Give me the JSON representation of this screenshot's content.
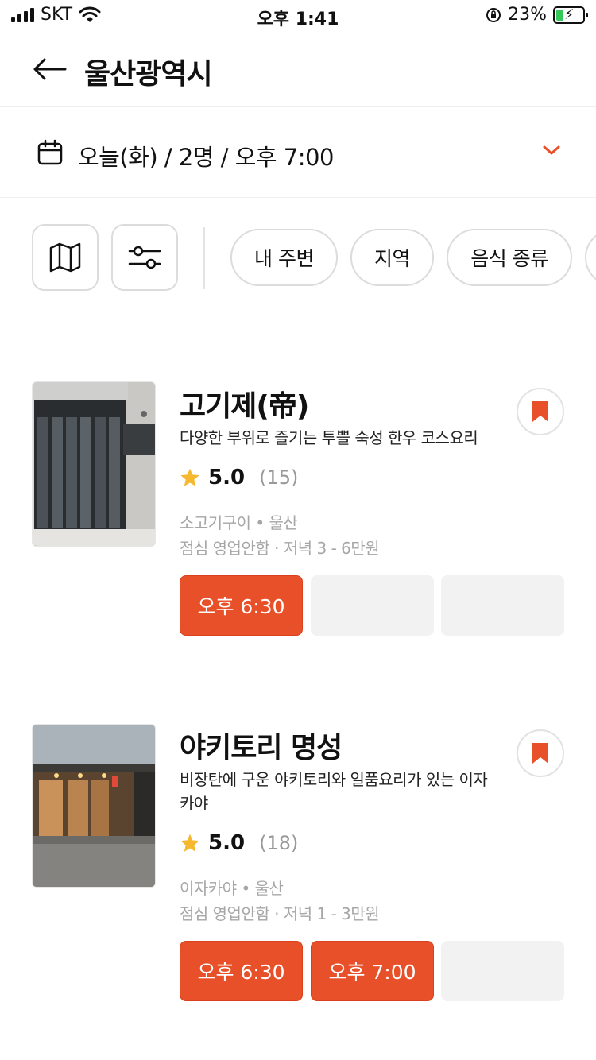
{
  "status_bar": {
    "carrier": "SKT",
    "time": "오후 1:41",
    "battery": "23%"
  },
  "header": {
    "title": "울산광역시"
  },
  "reservation": {
    "summary": "오늘(화) / 2명 / 오후 7:00"
  },
  "filters": {
    "chips": [
      "내 주변",
      "지역",
      "음식 종류"
    ]
  },
  "colors": {
    "accent": "#e8502a",
    "star": "#f5b82e",
    "muted": "#a6a6a6"
  },
  "restaurants": [
    {
      "name": "고기제(帝)",
      "description": "다양한 부위로 즐기는 투쁠 숙성 한우 코스요리",
      "rating": "5.0",
      "review_count": "(15)",
      "category_area": "소고기구이 • 울산",
      "hours_price": "점심 영업안함 · 저녁 3 - 6만원",
      "slots": [
        "오후 6:30",
        "",
        ""
      ]
    },
    {
      "name": "야키토리 명성",
      "description": "비장탄에 구운 야키토리와 일품요리가 있는 이자카야",
      "rating": "5.0",
      "review_count": "(18)",
      "category_area": "이자카야 • 울산",
      "hours_price": "점심 영업안함 · 저녁 1 - 3만원",
      "slots": [
        "오후 6:30",
        "오후 7:00",
        ""
      ]
    }
  ]
}
